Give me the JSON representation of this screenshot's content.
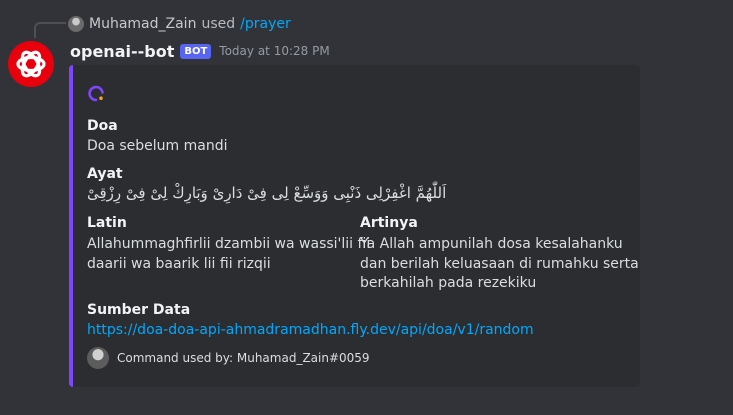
{
  "reply": {
    "user": "Muhamad_Zain",
    "used": "used",
    "command": "/prayer"
  },
  "message": {
    "username": "openai--bot",
    "bot_tag": "BOT",
    "timestamp": "Today at 10:28 PM",
    "avatar_icon": "openai-logo-icon",
    "avatar_color": "#e8000d"
  },
  "embed": {
    "accent_color": "#7f45ff",
    "fields": {
      "doa": {
        "name": "Doa",
        "value": "Doa sebelum mandi"
      },
      "ayat": {
        "name": "Ayat",
        "value": "اَللّٰهُمَّ اغْفِرْلِى ذَنْبِى وَوَسِّعْ لِى فِىْ دَارِىْ وَبَارِكْ لِىْ فِىْ رِزْقِىْ"
      },
      "latin": {
        "name": "Latin",
        "line1": "Allahummaghfirlii dzambii wa wassi'lii fii",
        "line2": "daarii wa baarik lii fii rizqii"
      },
      "artinya": {
        "name": "Artinya",
        "line1": "Ya Allah ampunilah dosa kesalahanku",
        "line2": "dan berilah keluasaan di rumahku serta",
        "line3": "berkahilah pada rezekiku"
      },
      "sumber": {
        "name": "Sumber Data",
        "value": "https://doa-doa-api-ahmadramadhan.fly.dev/api/doa/v1/random"
      }
    },
    "footer": "Command used by: Muhamad_Zain#0059"
  },
  "colors": {
    "background": "#313338",
    "embed_background": "#2b2d31",
    "link": "#00a8fc",
    "bot_tag": "#5865f2"
  }
}
